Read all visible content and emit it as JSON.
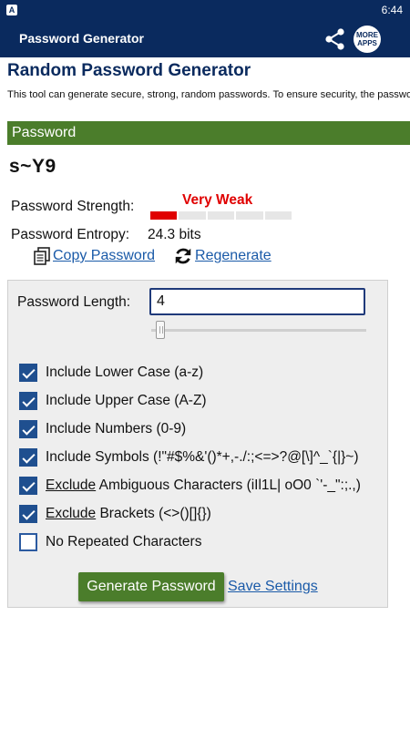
{
  "status_bar": {
    "time": "6:44",
    "notification_icon": "A"
  },
  "app_bar": {
    "title": "Password Generator",
    "share_icon": "share-icon",
    "more_apps_line1": "MORE",
    "more_apps_line2": "APPS"
  },
  "page": {
    "heading": "Random Password Generator",
    "description": "This tool can generate secure, strong, random passwords. To ensure security, the password is generated completely on the webpage without being sent across the In"
  },
  "password_section": {
    "bar_label": "Password",
    "generated_password": "s~Y9",
    "strength_label": "Password Strength:",
    "strength_value": "Very Weak",
    "strength_color": "#e00000",
    "strength_level": 1,
    "strength_segments": 5,
    "entropy_label": "Password Entropy:",
    "entropy_value": "24.3 bits",
    "copy_label": "Copy Password",
    "regenerate_label": "Regenerate"
  },
  "settings": {
    "length_label": "Password Length:",
    "length_value": "4",
    "options": [
      {
        "prefix": "",
        "label": "Include Lower Case (a-z)",
        "checked": true
      },
      {
        "prefix": "",
        "label": "Include Upper Case (A-Z)",
        "checked": true
      },
      {
        "prefix": "",
        "label": "Include Numbers (0-9)",
        "checked": true
      },
      {
        "prefix": "",
        "label": "Include Symbols (!\"#$%&'()*+,-./:;<=>?@[\\]^_`{|}~)",
        "checked": true
      },
      {
        "prefix": "Exclude",
        "label": " Ambiguous Characters (iIl1L| oO0 `'-_\":;.,)",
        "checked": true
      },
      {
        "prefix": "Exclude",
        "label": " Brackets (<>()[]{})",
        "checked": true
      },
      {
        "prefix": "",
        "label": "No Repeated Characters",
        "checked": false
      }
    ],
    "generate_label": "Generate Password",
    "save_label": "Save Settings"
  },
  "colors": {
    "app_bar": "#0a2a5e",
    "section_bar": "#4b7d2b",
    "link": "#1a5aa8",
    "checkbox": "#1f4f8f"
  }
}
